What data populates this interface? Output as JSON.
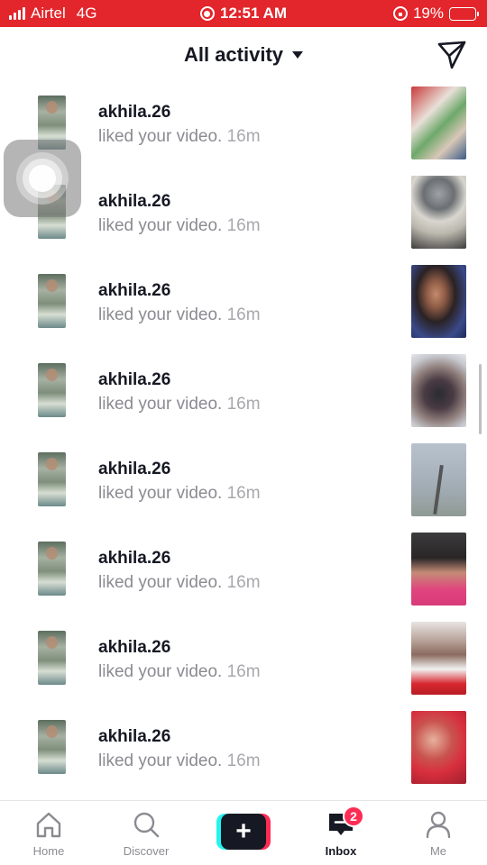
{
  "status_bar": {
    "carrier": "Airtel",
    "network": "4G",
    "time": "12:51 AM",
    "battery": "19%",
    "color": "#e3262b"
  },
  "header": {
    "title": "All activity"
  },
  "activities": [
    {
      "username": "akhila.26",
      "action": "liked your video.",
      "time": "16m"
    },
    {
      "username": "akhila.26",
      "action": "liked your video.",
      "time": "16m"
    },
    {
      "username": "akhila.26",
      "action": "liked your video.",
      "time": "16m"
    },
    {
      "username": "akhila.26",
      "action": "liked your video.",
      "time": "16m"
    },
    {
      "username": "akhila.26",
      "action": "liked your video.",
      "time": "16m"
    },
    {
      "username": "akhila.26",
      "action": "liked your video.",
      "time": "16m"
    },
    {
      "username": "akhila.26",
      "action": "liked your video.",
      "time": "16m"
    },
    {
      "username": "akhila.26",
      "action": "liked your video.",
      "time": "16m"
    }
  ],
  "bottom_nav": {
    "home": "Home",
    "discover": "Discover",
    "inbox": "Inbox",
    "inbox_badge": "2",
    "me": "Me"
  },
  "colors": {
    "accent_red": "#fe2c55",
    "accent_cyan": "#25f4ee",
    "text_dark": "#161823",
    "text_gray": "#8a8b91"
  }
}
